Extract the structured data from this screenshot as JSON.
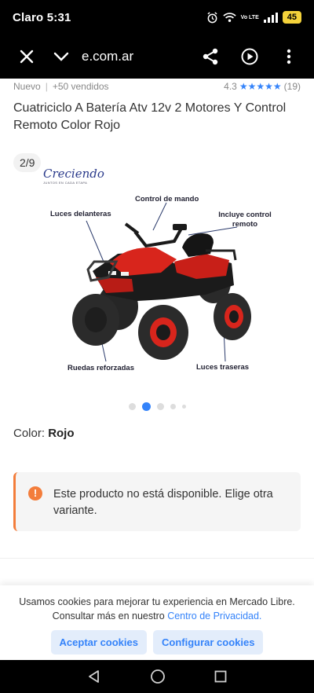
{
  "status_bar": {
    "carrier_time": "Claro 5:31",
    "network_label": "Vo LTE",
    "battery": "45",
    "icons": [
      "alarm-icon",
      "wifi-icon",
      "signal-icon",
      "battery-icon"
    ]
  },
  "browser": {
    "url": "e.com.ar",
    "icons": [
      "close-icon",
      "chevron-down-icon",
      "share-icon",
      "play-icon",
      "more-icon"
    ]
  },
  "product": {
    "condition": "Nuevo",
    "separator": "|",
    "sold": "+50 vendidos",
    "rating_value": "4.3",
    "stars": "★★★★★",
    "rating_count": "(19)",
    "title": "Cuatriciclo A Batería Atv 12v 2 Motores Y Control Remoto Color Rojo"
  },
  "gallery": {
    "counter": "2/9",
    "brand_name": "Creciendo",
    "brand_tagline": "JUNTOS EN CADA ETAPA",
    "annotations": {
      "front_lights": "Luces delanteras",
      "control": "Control de mando",
      "remote": "Incluye control remoto",
      "wheels": "Ruedas reforzadas",
      "rear_lights": "Luces traseras"
    },
    "dots_total": 5,
    "dot_active_index": 1
  },
  "color": {
    "label": "Color:",
    "value": "Rojo"
  },
  "notice": {
    "icon_glyph": "!",
    "text": "Este producto no está disponible. Elige otra variante."
  },
  "cookies": {
    "text_before_link": "Usamos cookies para mejorar tu experiencia en Mercado Libre. Consultar más en nuestro ",
    "link": "Centro de Privacidad.",
    "accept_button": "Aceptar cookies",
    "configure_button": "Configurar cookies"
  },
  "nav": {
    "icons": [
      "back-icon",
      "home-icon",
      "recents-icon"
    ]
  },
  "colors": {
    "accent_blue": "#3483fa",
    "warning_orange": "#f37d3b",
    "product_red": "#d8251c"
  }
}
